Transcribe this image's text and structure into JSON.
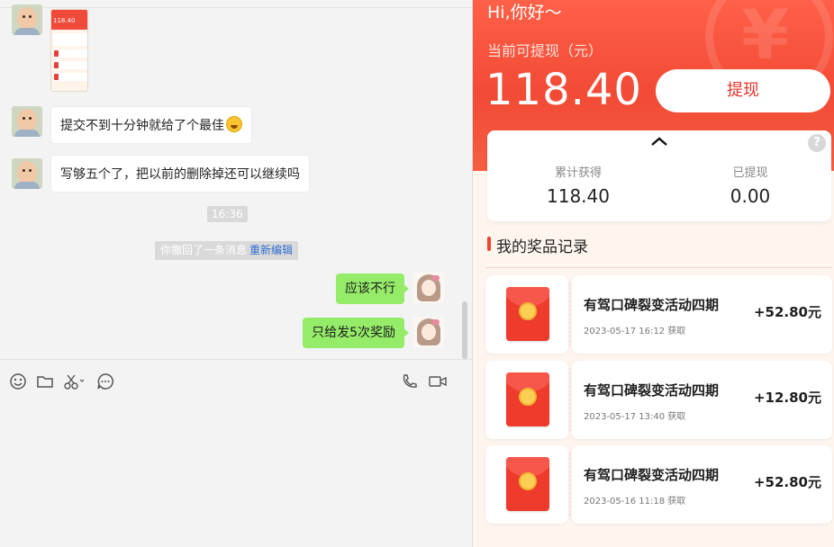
{
  "chat": {
    "thumb_amount": "118.40",
    "messages": [
      {
        "text": "提交不到十分钟就给了个最佳"
      },
      {
        "text": "写够五个了，把以前的删除掉还可以继续吗"
      },
      {
        "text": "应该不行"
      },
      {
        "text": "只给发5次奖励"
      }
    ],
    "time": "16:36",
    "recall_text": "你撤回了一条消息",
    "recall_link": "重新编辑",
    "toolbar": [
      "emoji-icon",
      "folder-icon",
      "scissors-icon",
      "chat-bubble-icon",
      "phone-icon",
      "video-icon"
    ]
  },
  "wallet": {
    "greeting": "Hi,你好～",
    "balance_label": "当前可提现（元）",
    "balance": "118.40",
    "withdraw_label": "提现",
    "help": "?",
    "stats": [
      {
        "label": "累计获得",
        "value": "118.40"
      },
      {
        "label": "已提现",
        "value": "0.00"
      }
    ],
    "section_title": "我的奖品记录",
    "records": [
      {
        "name": "有驾口碑裂变活动四期",
        "date": "2023-05-17 16:12 获取",
        "amount": "+52.80元"
      },
      {
        "name": "有驾口碑裂变活动四期",
        "date": "2023-05-17 13:40 获取",
        "amount": "+12.80元"
      },
      {
        "name": "有驾口碑裂变活动四期",
        "date": "2023-05-16 11:18 获取",
        "amount": "+52.80元"
      }
    ],
    "colors": {
      "accent": "#f24a35",
      "chat_out": "#95ec69"
    }
  }
}
